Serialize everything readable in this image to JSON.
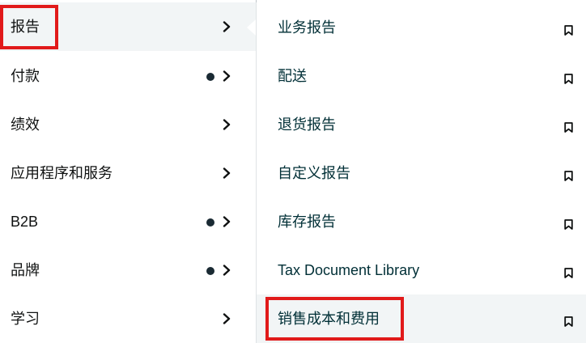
{
  "left_menu": {
    "items": [
      {
        "label": "报告",
        "has_dot": false
      },
      {
        "label": "付款",
        "has_dot": true
      },
      {
        "label": "绩效",
        "has_dot": false
      },
      {
        "label": "应用程序和服务",
        "has_dot": false
      },
      {
        "label": "B2B",
        "has_dot": true
      },
      {
        "label": "品牌",
        "has_dot": true
      },
      {
        "label": "学习",
        "has_dot": false
      }
    ],
    "active_index": 0
  },
  "submenu": {
    "items": [
      {
        "label": "业务报告"
      },
      {
        "label": "配送"
      },
      {
        "label": "退货报告"
      },
      {
        "label": "自定义报告"
      },
      {
        "label": "库存报告"
      },
      {
        "label": "Tax Document Library"
      },
      {
        "label": "销售成本和费用"
      }
    ],
    "hover_index": 6
  },
  "icons": {
    "chevron": "chevron-right-icon",
    "bookmark": "bookmark-icon",
    "dot": "notification-dot-icon"
  },
  "colors": {
    "highlight": "#e11a1a",
    "active_bg": "#f2f5f6",
    "dot": "#1a2a33",
    "submenu_text": "#002f36"
  }
}
